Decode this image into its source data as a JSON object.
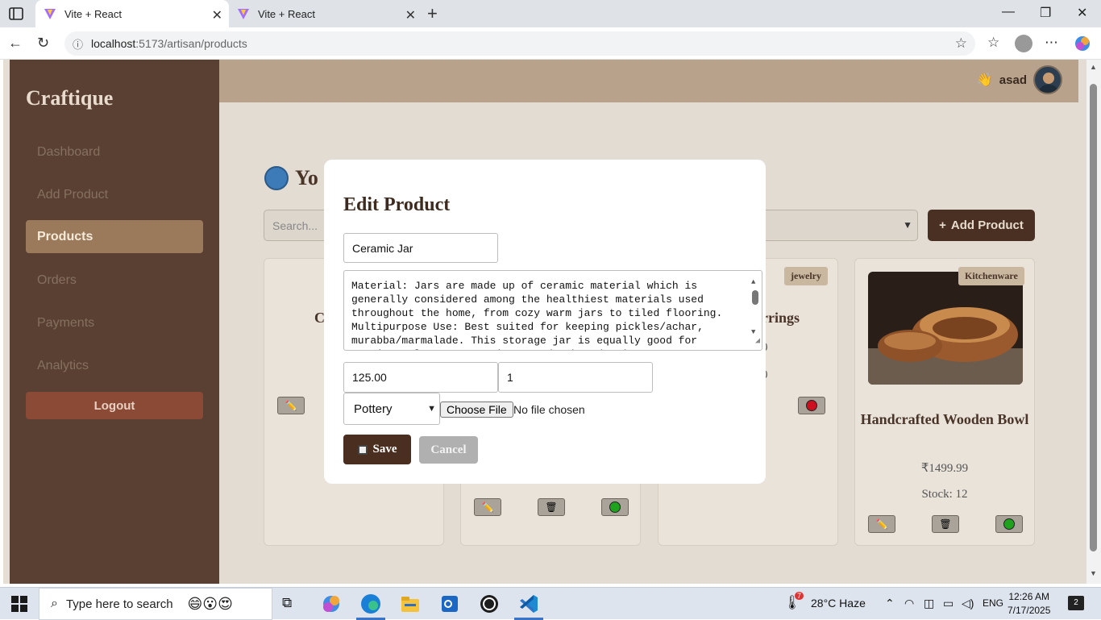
{
  "browser": {
    "tabs": [
      {
        "title": "Vite + React",
        "active": true
      },
      {
        "title": "Vite + React",
        "active": false
      }
    ],
    "url_host": "localhost",
    "url_path": ":5173/artisan/products"
  },
  "sidebar": {
    "brand": "Craftique",
    "items": [
      {
        "label": "Dashboard",
        "active": false
      },
      {
        "label": "Add Product",
        "active": false
      },
      {
        "label": "Products",
        "active": true
      },
      {
        "label": "Orders",
        "active": false
      },
      {
        "label": "Payments",
        "active": false
      },
      {
        "label": "Analytics",
        "active": false
      }
    ],
    "logout_label": "Logout"
  },
  "topbar": {
    "user_name": "asad"
  },
  "main": {
    "heading": "Yo",
    "search_placeholder": "Search...",
    "add_product_label": "Add Product",
    "cards": [
      {
        "title": "C",
        "badge": "",
        "price": "",
        "stock": ""
      },
      {
        "title": "",
        "badge": "",
        "price": "",
        "stock": ""
      },
      {
        "title": "rrings",
        "badge": "jewelry",
        "price": "0",
        "stock": "0"
      },
      {
        "title": "Handcrafted Wooden Bowl",
        "badge": "Kitchenware",
        "price": "₹1499.99",
        "stock": "Stock: 12"
      }
    ]
  },
  "modal": {
    "title": "Edit Product",
    "name_value": "Ceramic Jar",
    "description_value": "Material: Jars are made up of ceramic material which is generally considered among the healthiest materials used throughout the home, from cozy warm jars to tiled flooring. Multipurpose Use: Best suited for keeping pickles/achar, murabba/marmalade. This storage jar is equally good for storing salt, sugar, spices, and other dry items.",
    "price_value": "125.00",
    "stock_value": "1",
    "category_value": "Pottery",
    "file_button_label": "Choose File",
    "file_status": "No file chosen",
    "save_label": "Save",
    "cancel_label": "Cancel"
  },
  "taskbar": {
    "search_placeholder": "Type here to search",
    "weather": "28°C  Haze",
    "language": "ENG",
    "time": "12:26 AM",
    "date": "7/17/2025",
    "weather_badge": "7",
    "notification_count": "2"
  },
  "colors": {
    "sidebar_bg": "#5a4033",
    "active_nav": "#9b7a5c",
    "primary_button": "#4a3022",
    "logout_button": "#8a4a35"
  }
}
